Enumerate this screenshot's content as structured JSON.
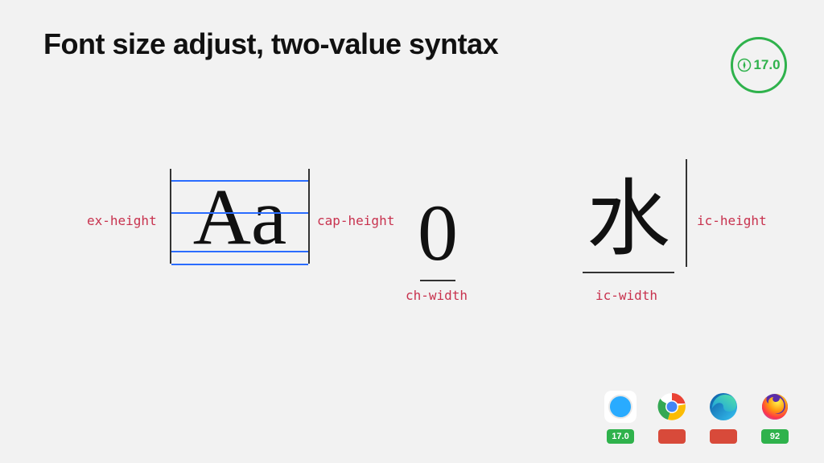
{
  "title": "Font size adjust, two-value syntax",
  "badge": {
    "version": "17.0"
  },
  "glyphs": {
    "aa": "Aa",
    "zero": "0",
    "cjk": "水"
  },
  "labels": {
    "ex_height": "ex-height",
    "cap_height": "cap-height",
    "ch_width": "ch-width",
    "ic_height": "ic-height",
    "ic_width": "ic-width"
  },
  "browsers": [
    {
      "name": "safari",
      "supported": true,
      "version": "17.0",
      "chip_class": "chip-green"
    },
    {
      "name": "chrome",
      "supported": false,
      "version": "",
      "chip_class": "chip-red"
    },
    {
      "name": "edge",
      "supported": false,
      "version": "",
      "chip_class": "chip-red"
    },
    {
      "name": "firefox",
      "supported": true,
      "version": "92",
      "chip_class": "chip-green"
    }
  ],
  "colors": {
    "accent_green": "#2fb24c",
    "accent_red": "#d84a3a",
    "guide_blue": "#2a6cff",
    "label_pink": "#c8324e"
  }
}
